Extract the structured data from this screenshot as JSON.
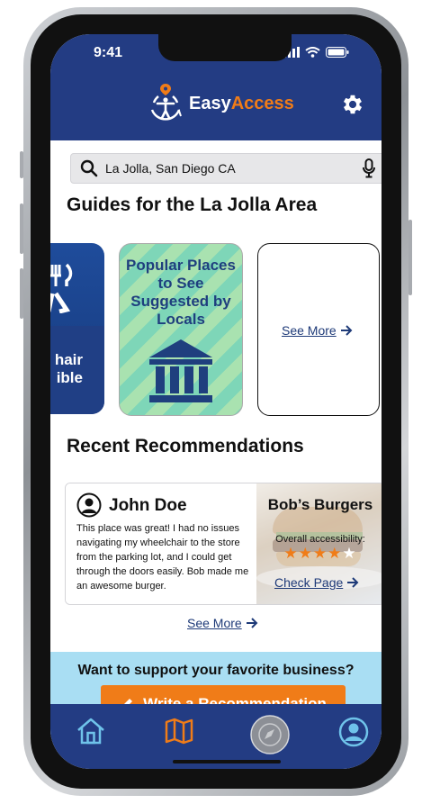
{
  "status_bar": {
    "time": "9:41"
  },
  "app": {
    "logo_part1": "Easy",
    "logo_part2": "Access"
  },
  "search": {
    "value": "La Jolla, San Diego CA"
  },
  "guides": {
    "heading": "Guides for the La Jolla Area",
    "card1_text_line1": "hair",
    "card1_text_line2": "ible",
    "card2_title": "Popular Places to See Suggested by Locals",
    "card3_link": "See More"
  },
  "recommendations": {
    "heading": "Recent Recommendations",
    "user_name": "John Doe",
    "review_text": "This place was great! I had no issues navigating my wheelchair to the store from the parking lot, and I could get through the doors easily. Bob made me an awesome burger.",
    "business_name": "Bob’s Burgers",
    "accessibility_label": "Overall accessibility:",
    "rating": 4,
    "rating_max": 5,
    "check_page_label": "Check Page",
    "see_more_label": "See More"
  },
  "cta": {
    "question": "Want to support your favorite business?",
    "button_label": "Write a Recommendation"
  },
  "tabbar": {
    "active_tab": "map",
    "items": [
      "home-icon",
      "map-icon",
      "compass-icon",
      "profile-icon"
    ]
  },
  "colors": {
    "primary": "#233c83",
    "accent": "#f07c18",
    "cta_bg": "#a9def3",
    "star": "#f07c18"
  }
}
